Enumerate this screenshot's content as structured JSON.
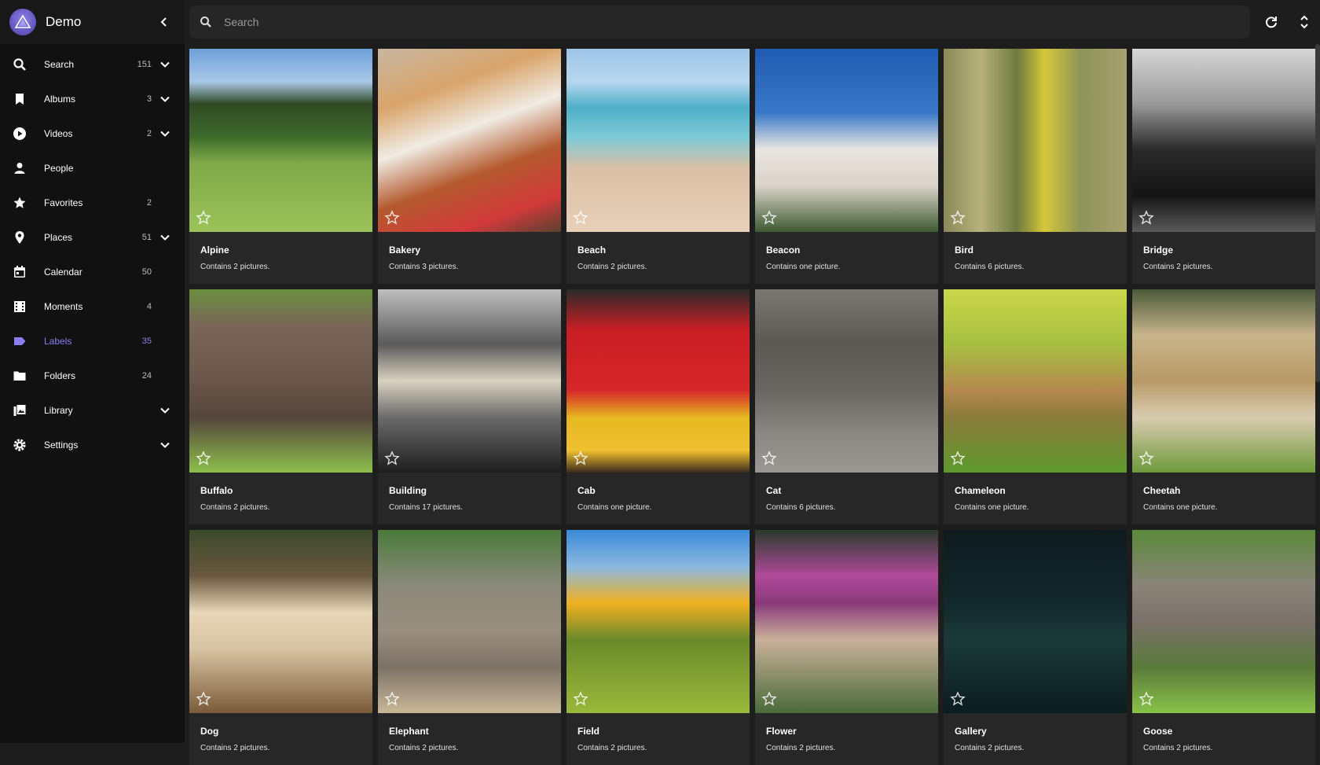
{
  "app": {
    "title": "Demo"
  },
  "search": {
    "placeholder": "Search"
  },
  "sidebar": {
    "items": [
      {
        "key": "search",
        "label": "Search",
        "count": "151",
        "chevron": true
      },
      {
        "key": "albums",
        "label": "Albums",
        "count": "3",
        "chevron": true
      },
      {
        "key": "videos",
        "label": "Videos",
        "count": "2",
        "chevron": true
      },
      {
        "key": "people",
        "label": "People",
        "count": "",
        "chevron": false
      },
      {
        "key": "favorites",
        "label": "Favorites",
        "count": "2",
        "chevron": false
      },
      {
        "key": "places",
        "label": "Places",
        "count": "51",
        "chevron": true
      },
      {
        "key": "calendar",
        "label": "Calendar",
        "count": "50",
        "chevron": false
      },
      {
        "key": "moments",
        "label": "Moments",
        "count": "4",
        "chevron": false
      },
      {
        "key": "labels",
        "label": "Labels",
        "count": "35",
        "chevron": false,
        "active": true
      },
      {
        "key": "folders",
        "label": "Folders",
        "count": "24",
        "chevron": false
      },
      {
        "key": "library",
        "label": "Library",
        "count": "",
        "chevron": true
      },
      {
        "key": "settings",
        "label": "Settings",
        "count": "",
        "chevron": true
      }
    ]
  },
  "colors": {
    "accent": "#8b7ff0",
    "sidebar_bg": "#111111",
    "card_bg": "#272727",
    "page_bg": "#1d1d1d"
  },
  "labels": [
    {
      "name": "Alpine",
      "desc": "Contains 2 pictures.",
      "bg": "linear-gradient(180deg,#6da0d8 0%,#a9c8e8 18%,#2f4a24 30%,#3e6a2c 48%,#7ea848 62%,#9cc25a 100%)"
    },
    {
      "name": "Bakery",
      "desc": "Contains 3 pictures.",
      "bg": "linear-gradient(160deg,#c7b7a0 0%,#d9a46a 25%,#f0ece4 45%,#b45a2e 65%,#d23a3a 85%,#5a4030 100%)"
    },
    {
      "name": "Beach",
      "desc": "Contains 2 pictures.",
      "bg": "linear-gradient(180deg,#9ec4e6 0%,#b6d7ef 18%,#4fb0c8 32%,#7cc9d6 48%,#d9c0a6 65%,#e8cfb8 100%)"
    },
    {
      "name": "Beacon",
      "desc": "Contains one picture.",
      "bg": "linear-gradient(180deg,#1f5bb0 0%,#3a78c9 35%,#e9e6e0 55%,#d8d2c8 75%,#3d5a30 100%)"
    },
    {
      "name": "Bird",
      "desc": "Contains 6 pictures.",
      "bg": "linear-gradient(90deg,#8a8a5a 0%,#b7b27a 20%,#6f7a40 40%,#d4c83a 55%,#8c9458 75%,#a8a070 100%)"
    },
    {
      "name": "Bridge",
      "desc": "Contains 2 pictures.",
      "bg": "linear-gradient(180deg,#d6d6d6 0%,#9a9a9a 30%,#2a2a2a 55%,#141414 80%,#5a5a5a 100%)"
    },
    {
      "name": "Buffalo",
      "desc": "Contains 2 pictures.",
      "bg": "linear-gradient(180deg,#6b8f3e 0%,#7a6658 20%,#6a564a 50%,#55463c 70%,#8dbf4c 100%)"
    },
    {
      "name": "Building",
      "desc": "Contains 17 pictures.",
      "bg": "linear-gradient(180deg,#bfbfbf 0%,#5a5a5a 30%,#d8d2c0 50%,#6a6a6a 70%,#1e1e1e 100%)"
    },
    {
      "name": "Cab",
      "desc": "Contains one picture.",
      "bg": "linear-gradient(180deg,#2a2a2a 0%,#c81e24 22%,#d6262a 55%,#e6b820 70%,#f0c030 88%,#3a2a1a 100%)"
    },
    {
      "name": "Cat",
      "desc": "Contains 6 pictures.",
      "bg": "linear-gradient(180deg,#7a7670 0%,#5c5852 30%,#6a6662 55%,#8c8884 80%,#9a9692 100%)"
    },
    {
      "name": "Chameleon",
      "desc": "Contains one picture.",
      "bg": "linear-gradient(180deg,#c9d64a 0%,#a7c040 30%,#b4884e 55%,#8a7a3a 70%,#5e9a2e 100%)"
    },
    {
      "name": "Cheetah",
      "desc": "Contains one picture.",
      "bg": "linear-gradient(180deg,#4a5a3a 0%,#c8b48a 25%,#b89a68 50%,#d9cbb0 70%,#6d9a3a 100%)"
    },
    {
      "name": "Dog",
      "desc": "Contains 2 pictures.",
      "bg": "linear-gradient(180deg,#3a4a2a 0%,#6a5840 25%,#e8d6b8 45%,#d8c4a2 65%,#7a5a3a 100%)"
    },
    {
      "name": "Elephant",
      "desc": "Contains 2 pictures.",
      "bg": "linear-gradient(180deg,#4a7a3a 0%,#8a8a7a 30%,#9a8e80 55%,#7d7266 75%,#c8b898 100%)"
    },
    {
      "name": "Field",
      "desc": "Contains 2 pictures.",
      "bg": "linear-gradient(180deg,#3a8ad8 0%,#8ab8e0 20%,#f0b020 40%,#6a8a2a 60%,#9ab83a 100%)"
    },
    {
      "name": "Flower",
      "desc": "Contains 2 pictures.",
      "bg": "linear-gradient(180deg,#2a3a2a 0%,#b04a9a 25%,#8a3a7a 40%,#c8b09a 60%,#4a6a3a 100%)"
    },
    {
      "name": "Gallery",
      "desc": "Contains 2 pictures.",
      "bg": "linear-gradient(180deg,#0e1a1e 0%,#12282c 40%,#1a3a38 60%,#0c1c1e 100%)"
    },
    {
      "name": "Goose",
      "desc": "Contains 2 pictures.",
      "bg": "linear-gradient(180deg,#5a8a3a 0%,#8a8478 30%,#7a726a 50%,#5a7a3a 75%,#8ac24a 100%)"
    }
  ]
}
